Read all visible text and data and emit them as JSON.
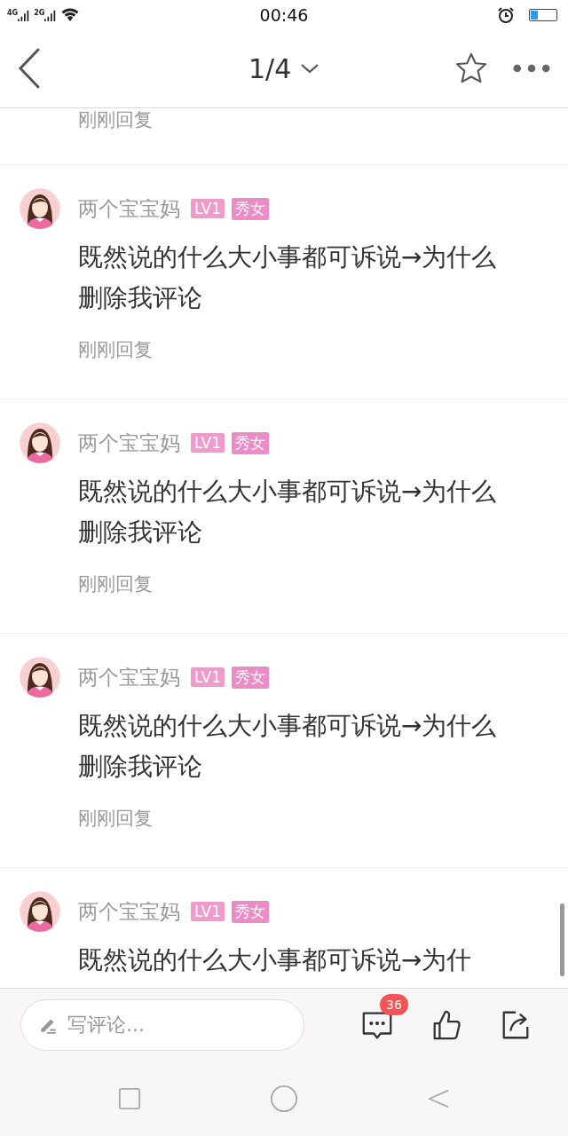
{
  "status_bar": {
    "network_1": "4G",
    "network_2": "2G",
    "time": "00:46"
  },
  "header": {
    "page_indicator": "1/4"
  },
  "partial_comment": {
    "reply": "刚刚回复"
  },
  "comments": [
    {
      "user": "两个宝宝妈",
      "level_badge": "LV1",
      "title_badge": "秀女",
      "text": "既然说的什么大小事都可诉说→为什么删除我评论",
      "reply": "刚刚回复"
    },
    {
      "user": "两个宝宝妈",
      "level_badge": "LV1",
      "title_badge": "秀女",
      "text": "既然说的什么大小事都可诉说→为什么删除我评论",
      "reply": "刚刚回复"
    },
    {
      "user": "两个宝宝妈",
      "level_badge": "LV1",
      "title_badge": "秀女",
      "text": "既然说的什么大小事都可诉说→为什么删除我评论",
      "reply": "刚刚回复"
    },
    {
      "user": "两个宝宝妈",
      "level_badge": "LV1",
      "title_badge": "秀女",
      "text": "既然说的什么大小事都可诉说→为什"
    }
  ],
  "bottom_bar": {
    "comment_placeholder": "写评论...",
    "comment_count": "36"
  }
}
